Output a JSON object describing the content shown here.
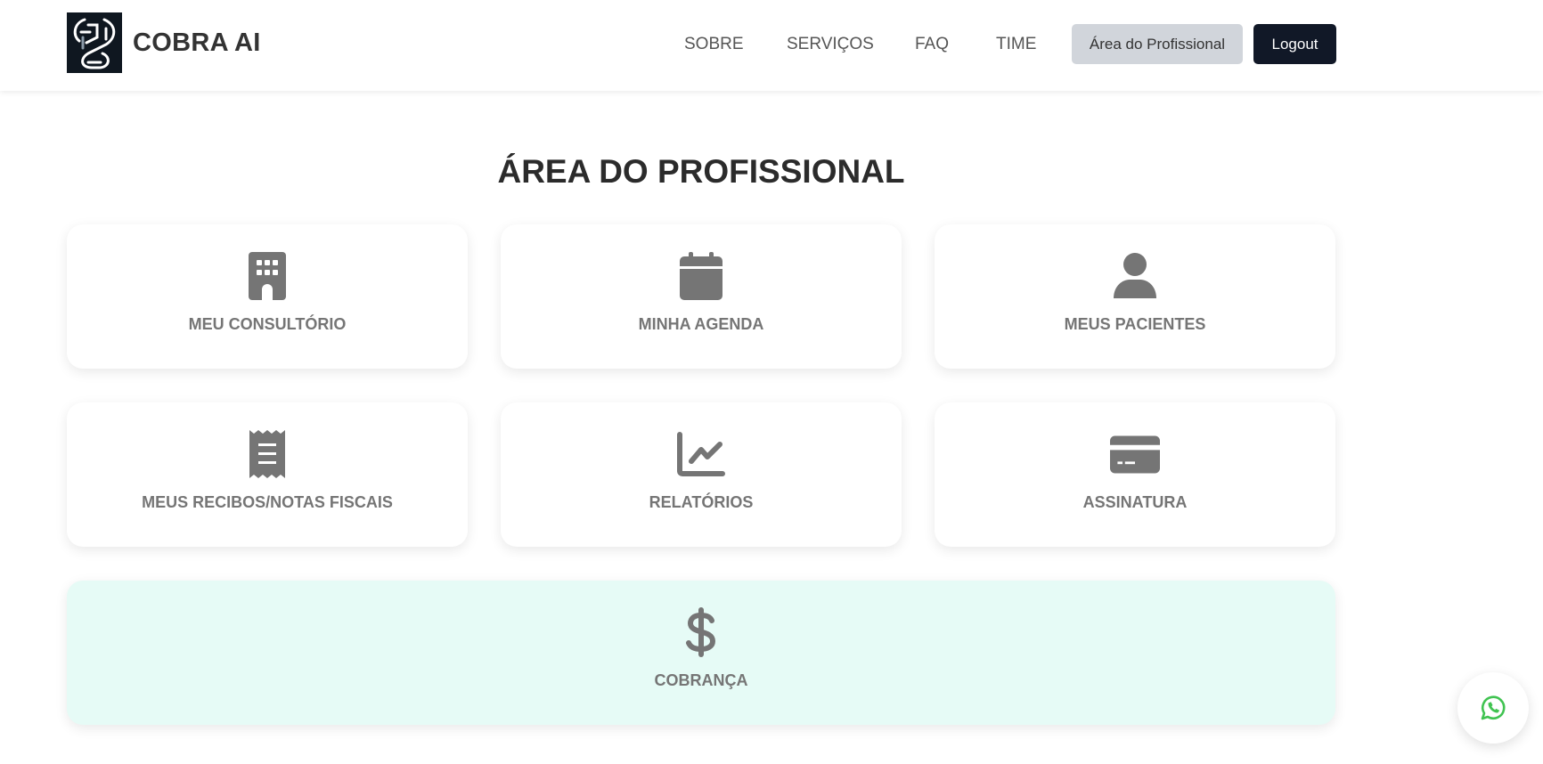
{
  "header": {
    "brand": "COBRA AI",
    "nav": [
      "SOBRE",
      "SERVIÇOS",
      "FAQ",
      "TIME"
    ],
    "area_button": "Área do Profissional",
    "logout_button": "Logout"
  },
  "main": {
    "title": "ÁREA DO PROFISSIONAL",
    "cards": [
      {
        "label": "MEU CONSULTÓRIO",
        "icon": "building-icon"
      },
      {
        "label": "MINHA AGENDA",
        "icon": "calendar-icon"
      },
      {
        "label": "MEUS PACIENTES",
        "icon": "user-icon"
      },
      {
        "label": "MEUS RECIBOS/NOTAS FISCAIS",
        "icon": "receipt-icon"
      },
      {
        "label": "RELATÓRIOS",
        "icon": "chart-line-icon"
      },
      {
        "label": "ASSINATURA",
        "icon": "credit-card-icon"
      },
      {
        "label": "COBRANÇA",
        "icon": "dollar-icon"
      }
    ]
  },
  "colors": {
    "icon": "#757575",
    "highlight_card": "#e6fbf6",
    "logout_bg": "#111827",
    "whatsapp": "#40c351"
  },
  "floating": {
    "icon": "whatsapp-icon"
  }
}
